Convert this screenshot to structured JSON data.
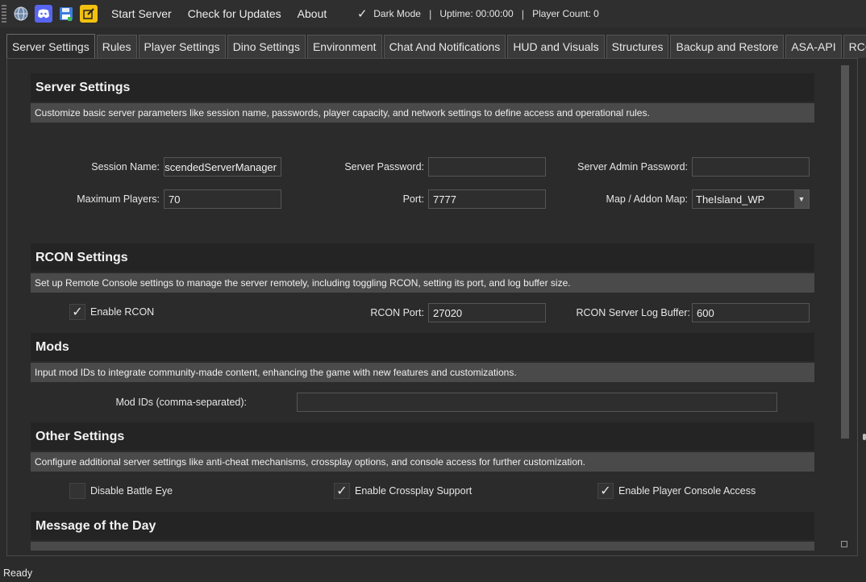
{
  "toolbar": {
    "icons": [
      {
        "name": "globe-icon"
      },
      {
        "name": "discord-icon"
      },
      {
        "name": "save-icon"
      },
      {
        "name": "edit-icon"
      }
    ],
    "start_server": "Start Server",
    "check_updates": "Check for Updates",
    "about": "About",
    "dark_mode_label": "Dark Mode",
    "dark_mode_checked": true,
    "uptime": "Uptime: 00:00:00",
    "player_count": "Player Count: 0",
    "separator": "|"
  },
  "tabs": [
    {
      "label": "Server Settings",
      "active": true
    },
    {
      "label": "Rules"
    },
    {
      "label": "Player Settings"
    },
    {
      "label": "Dino Settings"
    },
    {
      "label": "Environment"
    },
    {
      "label": "Chat And Notifications"
    },
    {
      "label": "HUD and Visuals"
    },
    {
      "label": "Structures"
    },
    {
      "label": "Backup and Restore"
    },
    {
      "label": "ASA-API"
    },
    {
      "label": "RCON"
    }
  ],
  "server_settings": {
    "title": "Server Settings",
    "description": "Customize basic server parameters like session name, passwords, player capacity, and network settings to define access and operational rules.",
    "session_name_label": "Session Name:",
    "session_name_value": "AscendedServerManager",
    "server_password_label": "Server Password:",
    "server_password_value": "",
    "admin_password_label": "Server Admin Password:",
    "admin_password_value": "",
    "max_players_label": "Maximum Players:",
    "max_players_value": "70",
    "port_label": "Port:",
    "port_value": "7777",
    "map_label": "Map / Addon Map:",
    "map_value": "TheIsland_WP"
  },
  "rcon": {
    "title": "RCON Settings",
    "description": "Set up Remote Console settings to manage the server remotely, including toggling RCON, setting its port, and log buffer size.",
    "enable_label": "Enable RCON",
    "enable_checked": true,
    "port_label": "RCON Port:",
    "port_value": "27020",
    "log_buffer_label": "RCON Server Log Buffer:",
    "log_buffer_value": "600"
  },
  "mods": {
    "title": "Mods",
    "description": "Input mod IDs to integrate community-made content, enhancing the game with new features and customizations.",
    "ids_label": "Mod IDs (comma-separated):",
    "ids_value": ""
  },
  "other": {
    "title": "Other Settings",
    "description": "Configure additional server settings like anti-cheat mechanisms, crossplay options, and console access for further customization.",
    "battleye_label": "Disable Battle Eye",
    "battleye_checked": false,
    "crossplay_label": "Enable Crossplay Support",
    "crossplay_checked": true,
    "console_label": "Enable Player Console Access",
    "console_checked": true
  },
  "motd": {
    "title": "Message of the Day"
  },
  "status": "Ready"
}
